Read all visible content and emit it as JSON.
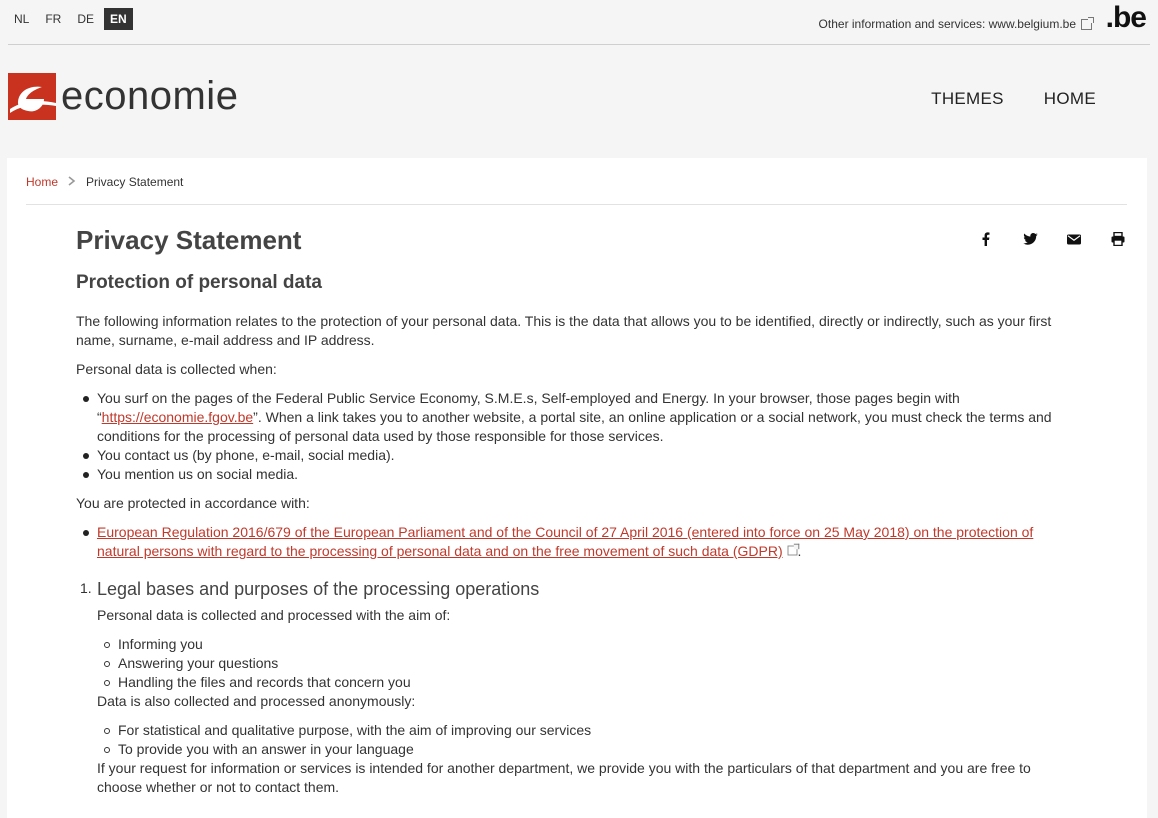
{
  "languages": [
    "NL",
    "FR",
    "DE",
    "EN"
  ],
  "active_language": "EN",
  "top_info": {
    "text": "Other information and services: www.belgium.be",
    "be_logo": ".be"
  },
  "logo": {
    "text": "economie"
  },
  "nav": {
    "themes": "THEMES",
    "home": "HOME"
  },
  "breadcrumb": {
    "home": "Home",
    "separator": ">",
    "current": "Privacy Statement"
  },
  "page": {
    "title": "Privacy Statement",
    "subtitle": "Protection of personal data",
    "intro": "The following information relates to the protection of your personal data. This is the data that allows you to be identified, directly or indirectly, such as your first name, surname, e-mail address and IP address.",
    "collected_when_label": "Personal data is collected when:",
    "collected_when": {
      "item1_pre": "You surf on the pages of the Federal Public Service Economy, S.M.E.s, Self-employed and Energy. In your browser, those pages begin with “",
      "item1_link": "https://economie.fgov.be",
      "item1_post": "”. When a link takes you to another website, a portal site, an online application or a social network, you must check the terms and conditions for the processing of personal data used by those responsible for those services.",
      "item2": "You contact us (by phone, e-mail, social media).",
      "item3": "You mention us on social media."
    },
    "protected_label": "You are protected in accordance with:",
    "regulation_link": "European Regulation 2016/679 of the European Parliament and of the Council of 27 April 2016 (entered into force on 25 May 2018) on the protection of natural persons with regard to the processing of personal data and on the free movement of such data (GDPR)",
    "regulation_suffix": ".",
    "section1": {
      "number": "1.",
      "title": "Legal bases and purposes of the processing operations",
      "aim_label": "Personal data is collected and processed with the aim of:",
      "aims": [
        "Informing you",
        "Answering your questions",
        "Handling the files and records that concern you"
      ],
      "anon_label": "Data is also collected and processed anonymously:",
      "anon": [
        "For statistical and qualitative purpose, with the aim of improving our services",
        "To provide you with an answer in your language"
      ],
      "closing": "If your request for information or services is intended for another department, we provide you with the particulars of that department and you are free to choose whether or not to contact them."
    }
  },
  "share_icons": [
    "facebook-icon",
    "twitter-icon",
    "email-icon",
    "print-icon"
  ],
  "colors": {
    "accent": "#c0392b",
    "logo_red": "#c8321e",
    "background": "#f5f5f5"
  }
}
